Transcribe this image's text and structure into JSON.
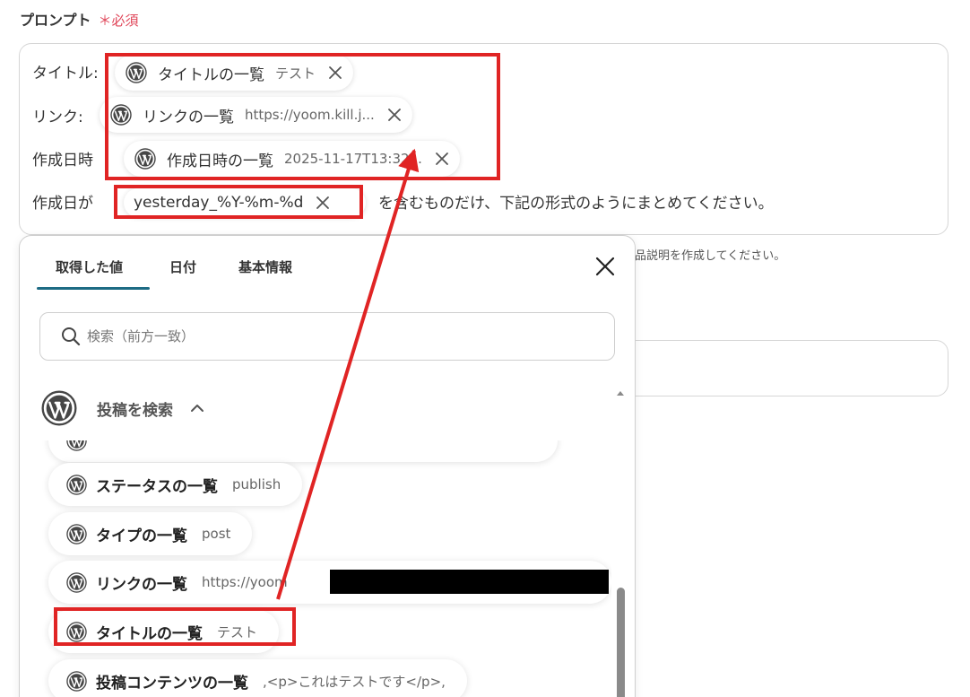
{
  "prompt_section": {
    "label": "プロンプト",
    "required_mark": "＊必須"
  },
  "prompt_lines": {
    "title_label": "タイトル:",
    "link_label": "リンク:",
    "created_at_label": "作成日時",
    "created_date_label": "作成日が",
    "instruction_text": "を含むものだけ、下記の形式のようにまとめてください。",
    "helper_text": "品説明を作成してください。"
  },
  "prompt_chips": [
    {
      "name": "タイトルの一覧",
      "value": "テスト"
    },
    {
      "name": "リンクの一覧",
      "value": "https://yoom.kill.j..."
    },
    {
      "name": "作成日時の一覧",
      "value": "2025-11-17T13:32..."
    }
  ],
  "date_chip": {
    "name": "yesterday_%Y-%m-%d"
  },
  "popup": {
    "tabs": [
      {
        "label": "取得した値"
      },
      {
        "label": "日付"
      },
      {
        "label": "基本情報"
      }
    ],
    "active_tab": "取得した値",
    "search_placeholder": "検索（前方一致）",
    "group_title": "投稿を検索",
    "items": [
      {
        "name": "ステータスの一覧",
        "value": "publish"
      },
      {
        "name": "タイプの一覧",
        "value": "post"
      },
      {
        "name": "リンクの一覧",
        "value": "https://yoom"
      },
      {
        "name": "タイトルの一覧",
        "value": "テスト"
      },
      {
        "name": "投稿コンテンツの一覧",
        "value": ",<p>これはテストです</p>,"
      }
    ]
  },
  "colors": {
    "annotation_red": "#e02424",
    "tab_accent": "#1e6b84",
    "required_red": "#e0475a"
  },
  "icons": {
    "wordpress": "wordpress-icon",
    "close": "close-icon",
    "search": "search-icon",
    "chevron": "chevron-up-icon"
  }
}
